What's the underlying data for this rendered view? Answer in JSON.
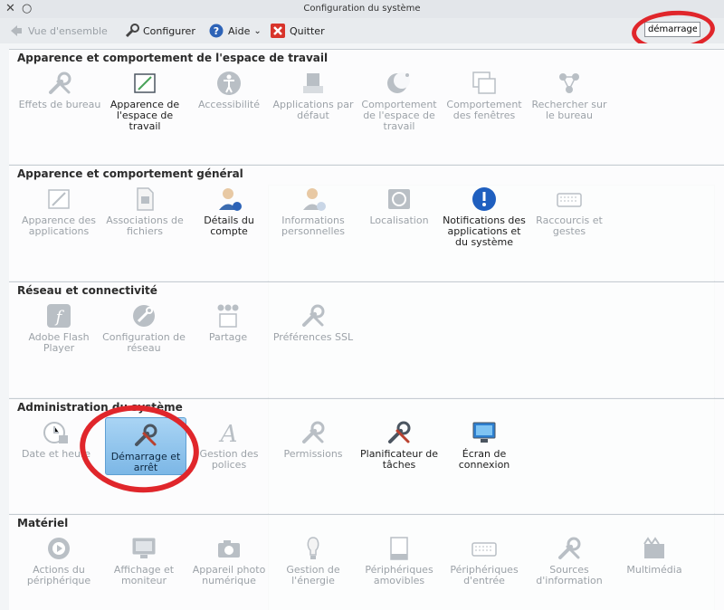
{
  "window": {
    "title": "Configuration du système"
  },
  "toolbar": {
    "overview": "Vue d'ensemble",
    "configure": "Configurer",
    "help": "Aide",
    "quit": "Quitter",
    "search_value": "démarrage"
  },
  "sections": [
    {
      "title": "Apparence et comportement de l'espace de travail",
      "items": [
        {
          "label": "Effets de bureau",
          "icon": "desktop-effects-icon",
          "active": false
        },
        {
          "label": "Apparence de l'espace de travail",
          "icon": "workspace-appearance-icon",
          "active": true
        },
        {
          "label": "Accessibilité",
          "icon": "accessibility-icon",
          "active": false
        },
        {
          "label": "Applications par défaut",
          "icon": "default-applications-icon",
          "active": false
        },
        {
          "label": "Comportement de l'espace de travail",
          "icon": "workspace-behavior-icon",
          "active": false
        },
        {
          "label": "Comportement des fenêtres",
          "icon": "window-behavior-icon",
          "active": false
        },
        {
          "label": "Rechercher sur le bureau",
          "icon": "desktop-search-icon",
          "active": false
        }
      ]
    },
    {
      "title": "Apparence et comportement général",
      "items": [
        {
          "label": "Apparence des applications",
          "icon": "application-appearance-icon",
          "active": false
        },
        {
          "label": "Associations de fichiers",
          "icon": "file-associations-icon",
          "active": false
        },
        {
          "label": "Détails du compte",
          "icon": "account-details-icon",
          "active": true
        },
        {
          "label": "Informations personnelles",
          "icon": "personal-info-icon",
          "active": false
        },
        {
          "label": "Localisation",
          "icon": "locale-icon",
          "active": false
        },
        {
          "label": "Notifications des applications et du système",
          "icon": "notifications-icon",
          "active": true
        },
        {
          "label": "Raccourcis et gestes",
          "icon": "shortcuts-icon",
          "active": false
        }
      ]
    },
    {
      "title": "Réseau et connectivité",
      "items": [
        {
          "label": "Adobe Flash Player",
          "icon": "flash-player-icon",
          "active": false
        },
        {
          "label": "Configuration de réseau",
          "icon": "network-settings-icon",
          "active": false
        },
        {
          "label": "Partage",
          "icon": "sharing-icon",
          "active": false
        },
        {
          "label": "Préférences SSL",
          "icon": "ssl-preferences-icon",
          "active": false
        }
      ]
    },
    {
      "title": "Administration du système",
      "items": [
        {
          "label": "Date et heure",
          "icon": "date-time-icon",
          "active": false
        },
        {
          "label": "Démarrage et arrêt",
          "icon": "startup-shutdown-icon",
          "active": true,
          "selected": true
        },
        {
          "label": "Gestion des polices",
          "icon": "font-management-icon",
          "active": false
        },
        {
          "label": "Permissions",
          "icon": "permissions-icon",
          "active": false
        },
        {
          "label": "Planificateur de tâches",
          "icon": "task-scheduler-icon",
          "active": true
        },
        {
          "label": "Écran de connexion",
          "icon": "login-screen-icon",
          "active": true
        }
      ]
    },
    {
      "title": "Matériel",
      "items": [
        {
          "label": "Actions du périphérique",
          "icon": "device-actions-icon",
          "active": false
        },
        {
          "label": "Affichage et moniteur",
          "icon": "display-monitor-icon",
          "active": false
        },
        {
          "label": "Appareil photo numérique",
          "icon": "digital-camera-icon",
          "active": false
        },
        {
          "label": "Gestion de l'énergie",
          "icon": "power-management-icon",
          "active": false
        },
        {
          "label": "Périphériques amovibles",
          "icon": "removable-devices-icon",
          "active": false
        },
        {
          "label": "Périphériques d'entrée",
          "icon": "input-devices-icon",
          "active": false
        },
        {
          "label": "Sources d'information",
          "icon": "information-sources-icon",
          "active": false
        },
        {
          "label": "Multimédia",
          "icon": "multimedia-icon",
          "active": false
        }
      ]
    }
  ],
  "colors": {
    "annotation_red": "#e0262b",
    "selection_blue": "#7cb7e6",
    "inactive_text": "#9ca2a8"
  }
}
